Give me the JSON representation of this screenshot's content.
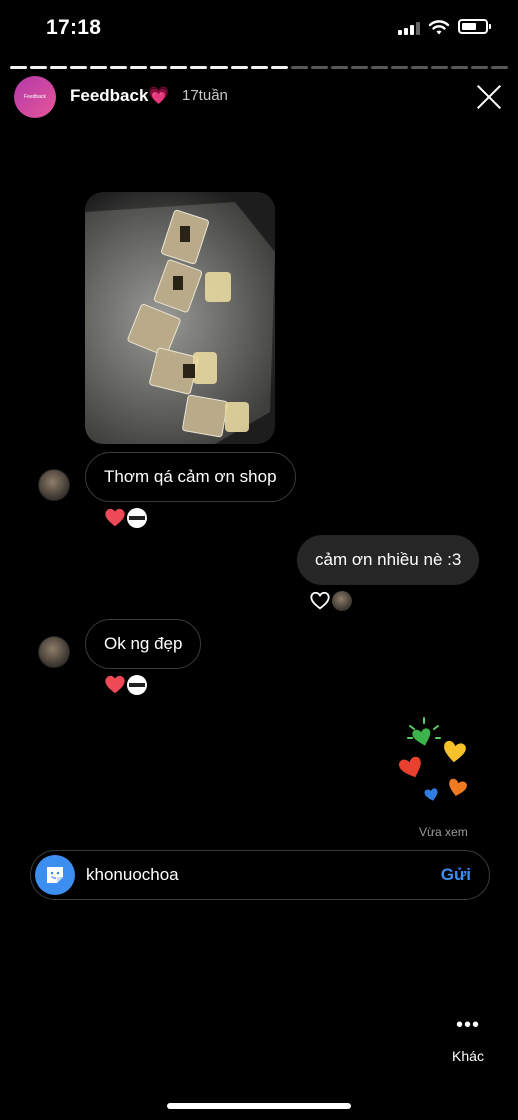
{
  "status_bar": {
    "time": "17:18"
  },
  "story": {
    "progress_segments_done": 14,
    "progress_segments_total": 25,
    "avatar_label": "Feedback",
    "title": "Feedback💗",
    "age": "17tuần"
  },
  "messages": [
    {
      "side": "in",
      "text": "Thơm qá cảm ơn shop"
    },
    {
      "side": "out",
      "text": "cảm ơn nhiều nè :3"
    },
    {
      "side": "in",
      "text": "Ok ng đẹp"
    }
  ],
  "seen_label": "Vừa xem",
  "reply": {
    "value": "khonuochoa",
    "send_label": "Gửi"
  },
  "more": {
    "label": "Khác"
  },
  "colors": {
    "accent": "#3d8ef1",
    "heart": "#ed4956",
    "avatar_gradient_start": "#b23aa8",
    "avatar_gradient_end": "#e8559a"
  },
  "icons": [
    "signal-icon",
    "wifi-icon",
    "battery-icon",
    "close-icon",
    "heart-icon",
    "sticker-icon",
    "more-dots-icon"
  ]
}
